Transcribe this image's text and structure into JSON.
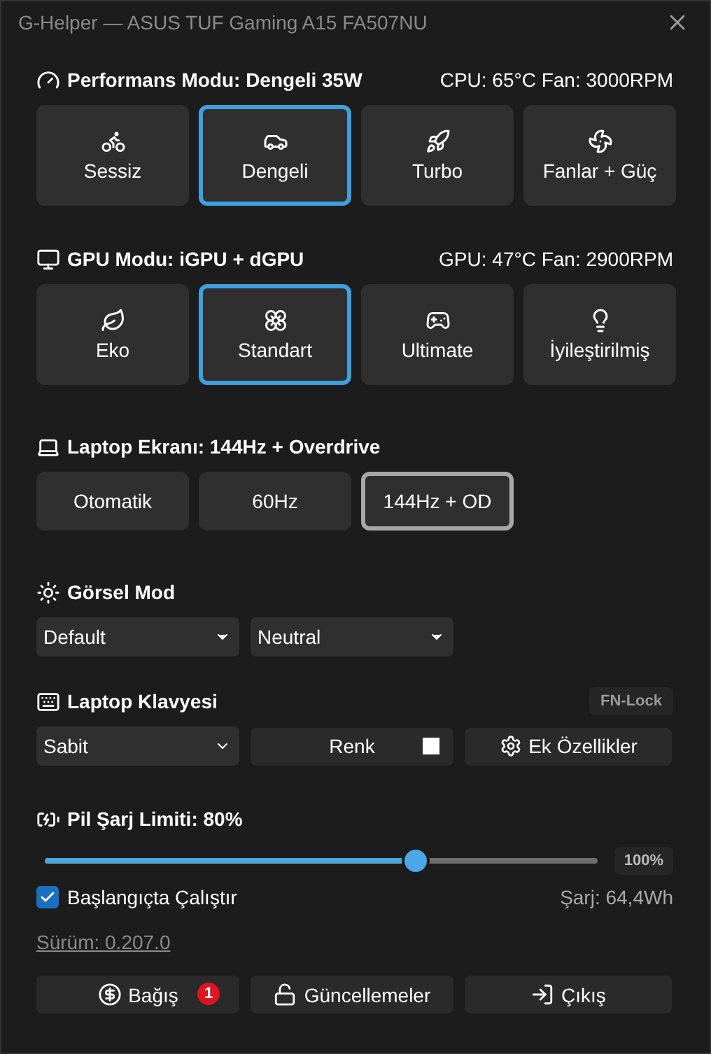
{
  "window": {
    "title": "G-Helper — ASUS TUF Gaming A15 FA507NU"
  },
  "performance": {
    "title": "Performans Modu: Dengeli 35W",
    "status": "CPU: 65°C Fan: 3000RPM",
    "modes": [
      {
        "label": "Sessiz",
        "kind": "bike",
        "selected": false
      },
      {
        "label": "Dengeli",
        "kind": "car",
        "selected": true
      },
      {
        "label": "Turbo",
        "kind": "rocket",
        "selected": false
      },
      {
        "label": "Fanlar + Güç",
        "kind": "fan",
        "selected": false
      }
    ]
  },
  "gpu": {
    "title": "GPU Modu: iGPU + dGPU",
    "status": "GPU: 47°C Fan: 2900RPM",
    "modes": [
      {
        "label": "Eko",
        "kind": "leaf",
        "selected": false
      },
      {
        "label": "Standart",
        "kind": "flower",
        "selected": true
      },
      {
        "label": "Ultimate",
        "kind": "gamepad",
        "selected": false
      },
      {
        "label": "İyileştirilmiş",
        "kind": "bulb",
        "selected": false
      }
    ]
  },
  "screen": {
    "title": "Laptop Ekranı: 144Hz + Overdrive",
    "modes": [
      {
        "label": "Otomatik",
        "selected": false
      },
      {
        "label": "60Hz",
        "selected": false
      },
      {
        "label": "144Hz + OD",
        "selected": true
      }
    ]
  },
  "visual": {
    "title": "Görsel Mod",
    "dropdowns": [
      "Default",
      "Neutral"
    ]
  },
  "keyboard": {
    "title": "Laptop Klavyesi",
    "fn_lock": "FN-Lock",
    "mode": "Sabit",
    "color_button": "Renk",
    "color": "#ffffff",
    "extra": "Ek Özellikler"
  },
  "battery": {
    "title": "Pil Şarj Limiti: 80%",
    "level": 0.67,
    "max_label": "100%"
  },
  "startup": {
    "label": "Başlangıçta Çalıştır",
    "checked": true
  },
  "charge": "Şarj: 64,4Wh",
  "version": "Sürüm: 0.207.0",
  "footer": [
    {
      "label": "Bağış",
      "kind": "donate",
      "badge": "1"
    },
    {
      "label": "Güncellemeler",
      "kind": "updates"
    },
    {
      "label": "Çıkış",
      "kind": "quit"
    }
  ]
}
